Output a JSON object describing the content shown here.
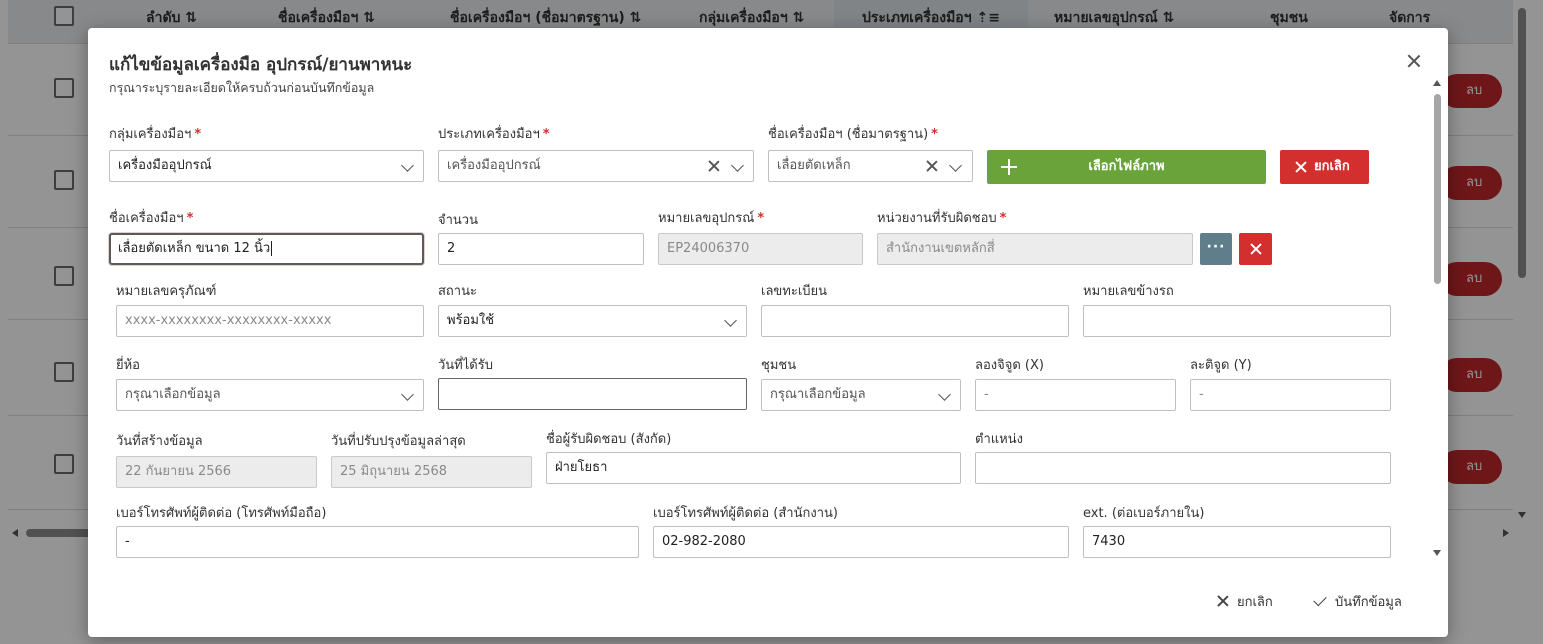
{
  "background_table": {
    "columns": [
      "ลำดับ",
      "ชื่อเครื่องมือฯ",
      "ชื่อเครื่องมือฯ (ชื่อมาตรฐาน)",
      "กลุ่มเครื่องมือฯ",
      "ประเภทเครื่องมือฯ",
      "หมายเลขอุปกรณ์",
      "ชุมชน",
      "จัดการ"
    ],
    "sort_icon": "⇅",
    "sort_active_icon": "⇡≡",
    "delete_label": "ลบ",
    "delete_icon": "trash-icon"
  },
  "modal": {
    "title": "แก้ไขข้อมูลเครื่องมือ อุปกรณ์/ยานพาหนะ",
    "subtitle": "กรุณาระบุรายละเอียดให้ครบถ้วนก่อนบันทึกข้อมูล",
    "required_mark": "*",
    "fields": {
      "group": {
        "label": "กลุ่มเครื่องมือฯ",
        "value": "เครื่องมืออุปกรณ์"
      },
      "type": {
        "label": "ประเภทเครื่องมือฯ",
        "value": "เครื่องมืออุปกรณ์"
      },
      "standard_name": {
        "label": "ชื่อเครื่องมือฯ (ชื่อมาตรฐาน)",
        "value": "เลื่อยตัดเหล็ก"
      },
      "name": {
        "label": "ชื่อเครื่องมือฯ",
        "value": "เลื่อยตัดเหล็ก ขนาด 12 นิ้ว"
      },
      "quantity": {
        "label": "จำนวน",
        "value": "2"
      },
      "equipment_no": {
        "label": "หมายเลขอุปกรณ์",
        "value": "EP24006370"
      },
      "responsible_unit": {
        "label": "หน่วยงานที่รับผิดชอบ",
        "value": "สำนักงานเขตหลักสี่"
      },
      "asset_no": {
        "label": "หมายเลขครุภัณฑ์",
        "placeholder": "xxxx-xxxxxxxx-xxxxxxxx-xxxxx"
      },
      "status": {
        "label": "สถานะ",
        "value": "พร้อมใช้"
      },
      "registration": {
        "label": "เลขทะเบียน",
        "value": ""
      },
      "vehicle_side_no": {
        "label": "หมายเลขข้างรถ",
        "value": ""
      },
      "brand": {
        "label": "ยี่ห้อ",
        "placeholder": "กรุณาเลือกข้อมูล"
      },
      "received_date": {
        "label": "วันที่ได้รับ",
        "value": ""
      },
      "community": {
        "label": "ชุมชน",
        "placeholder": "กรุณาเลือกข้อมูล"
      },
      "longitude": {
        "label": "ลองจิจูด (X)",
        "value": "-"
      },
      "latitude": {
        "label": "ละติจูด (Y)",
        "value": "-"
      },
      "created_date": {
        "label": "วันที่สร้างข้อมูล",
        "value": "22 กันยายน 2566"
      },
      "updated_date": {
        "label": "วันที่ปรับปรุงข้อมูลล่าสุด",
        "value": "25 มิถุนายน 2568"
      },
      "responsible_person": {
        "label": "ชื่อผู้รับผิดชอบ (สังกัด)",
        "value": "ฝ่ายโยธา"
      },
      "position": {
        "label": "ตำแหน่ง",
        "value": ""
      },
      "mobile": {
        "label": "เบอร์โทรศัพท์ผู้ติดต่อ (โทรศัพท์มือถือ)",
        "value": "-"
      },
      "office_phone": {
        "label": "เบอร์โทรศัพท์ผู้ติดต่อ (สำนักงาน)",
        "value": "02-982-2080"
      },
      "ext": {
        "label": "ext. (ต่อเบอร์ภายใน)",
        "value": "7430"
      }
    },
    "buttons": {
      "choose_image": "เลือกไฟล์ภาพ",
      "cancel_top": "ยกเลิก",
      "more": "···",
      "cancel_footer": "ยกเลิก",
      "save": "บันทึกข้อมูล"
    },
    "colors": {
      "green": "#6aa33a",
      "red": "#d32f2f",
      "slate": "#607d8b"
    }
  }
}
